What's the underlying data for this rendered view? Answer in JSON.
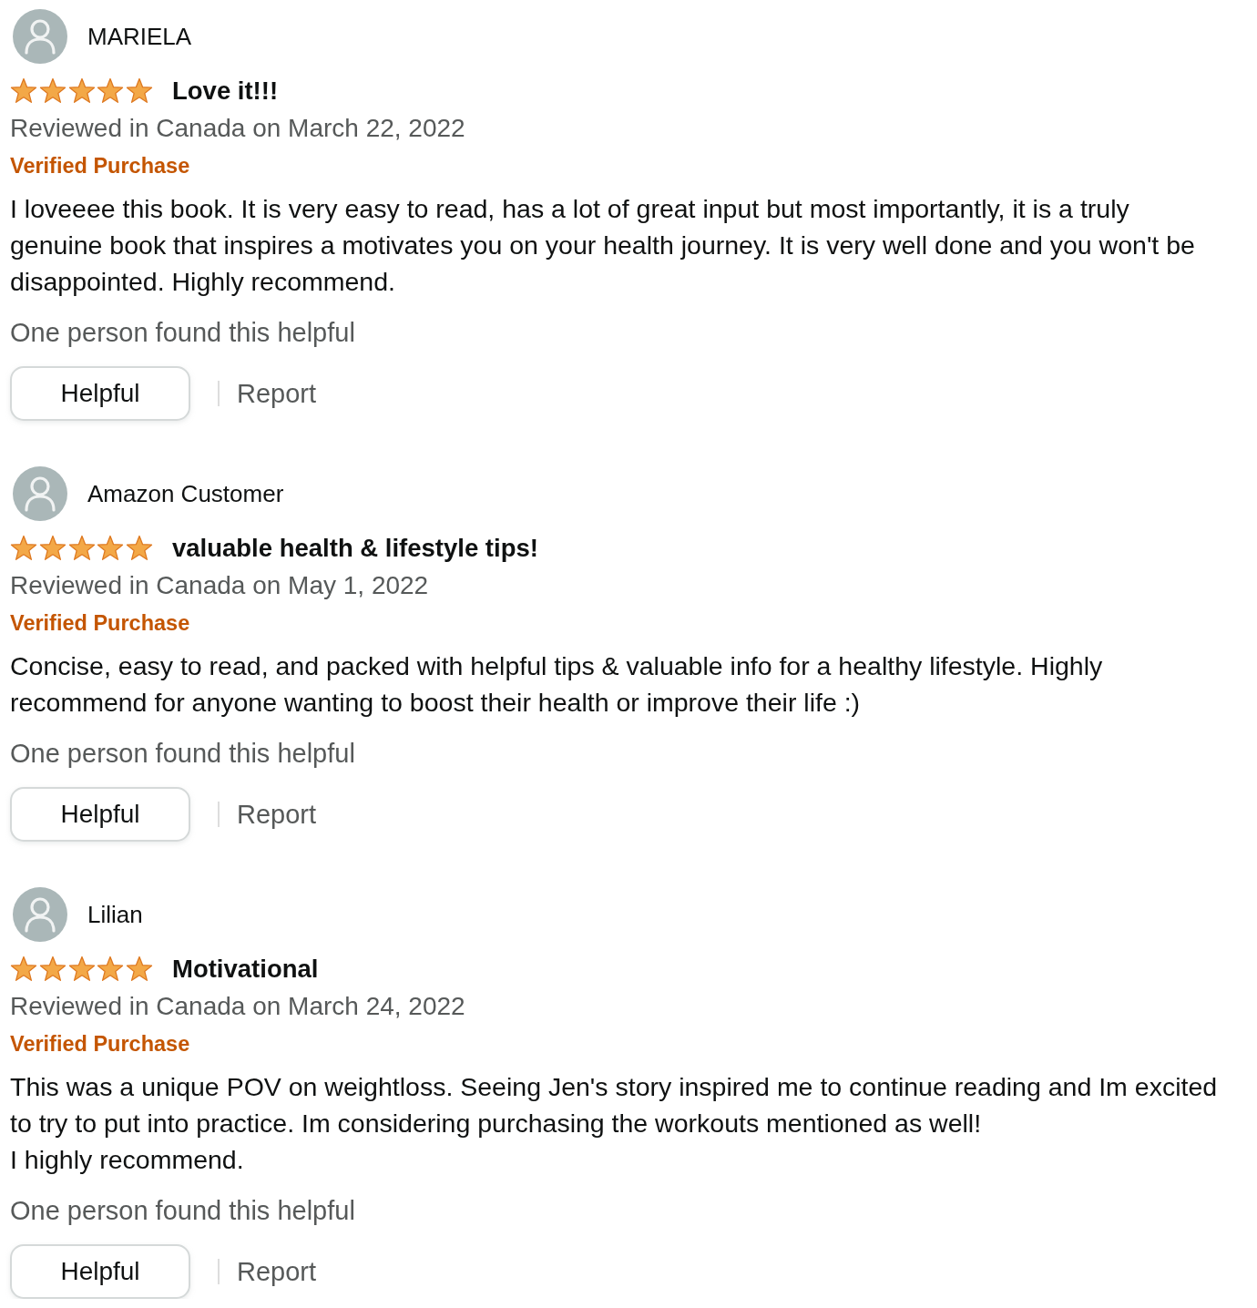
{
  "reviews": [
    {
      "author": "MARIELA",
      "stars": 5,
      "title": "Love it!!!",
      "date": "Reviewed in Canada on March 22, 2022",
      "badge": "Verified Purchase",
      "body": [
        "I loveeee this book. It is very easy to read, has a lot of great input but most importantly, it is a truly genuine book that inspires a motivates you on your health journey. It is very well done and you won't be disappointed. Highly recommend."
      ],
      "helpful_count": "One person found this helpful",
      "helpful_button": "Helpful",
      "report_link": "Report"
    },
    {
      "author": "Amazon Customer",
      "stars": 5,
      "title": "valuable health & lifestyle tips!",
      "date": "Reviewed in Canada on May 1, 2022",
      "badge": "Verified Purchase",
      "body": [
        "Concise, easy to read, and packed with helpful tips & valuable info for a healthy lifestyle. Highly recommend for anyone wanting to boost their health or improve their life :)"
      ],
      "helpful_count": "One person found this helpful",
      "helpful_button": "Helpful",
      "report_link": "Report"
    },
    {
      "author": "Lilian",
      "stars": 5,
      "title": "Motivational",
      "date": "Reviewed in Canada on March 24, 2022",
      "badge": "Verified Purchase",
      "body": [
        "This was a unique POV on weightloss. Seeing Jen's story inspired me to continue reading and Im excited to try to put into practice. Im considering purchasing the workouts mentioned as well!",
        "I highly recommend."
      ],
      "helpful_count": "One person found this helpful",
      "helpful_button": "Helpful",
      "report_link": "Report"
    }
  ]
}
